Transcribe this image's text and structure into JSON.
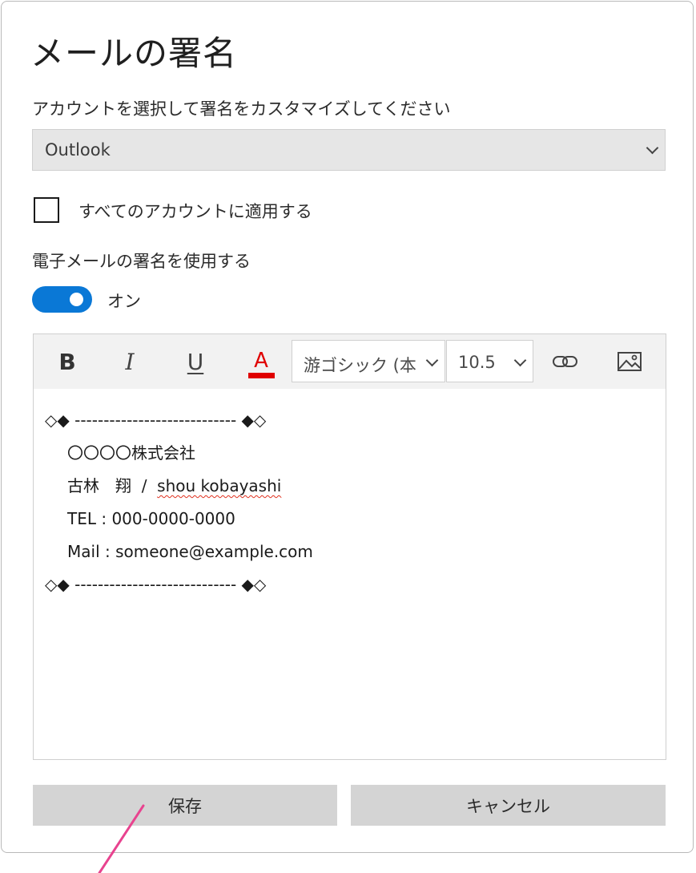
{
  "dialog": {
    "title": "メールの署名",
    "subtitle": "アカウントを選択して署名をカスタマイズしてください",
    "account_select": {
      "value": "Outlook"
    },
    "apply_all": {
      "label": "すべてのアカウントに適用する",
      "checked": false
    },
    "use_signature": {
      "label": "電子メールの署名を使用する"
    },
    "toggle": {
      "state": "on",
      "label": "オン"
    }
  },
  "toolbar": {
    "bold": "B",
    "italic": "I",
    "underline": "U",
    "font_color": {
      "letter": "A",
      "color": "#e00000"
    },
    "font_family": "游ゴシック (本",
    "font_size": "10.5",
    "link_icon": "link-icon",
    "image_icon": "image-icon"
  },
  "signature": {
    "line1": "◇◆ ---------------------------- ◆◇",
    "company": "〇〇〇〇株式会社",
    "name_jp": "古林　翔",
    "name_sep": "  /  ",
    "name_en": "shou kobayashi",
    "tel": "TEL : 000-0000-0000",
    "mail": "Mail : someone@example.com",
    "line_end": "◇◆ ---------------------------- ◆◇"
  },
  "buttons": {
    "save": "保存",
    "cancel": "キャンセル"
  },
  "colors": {
    "toggle_on": "#0a78d6",
    "pointer_arrow": "#e8438f"
  }
}
